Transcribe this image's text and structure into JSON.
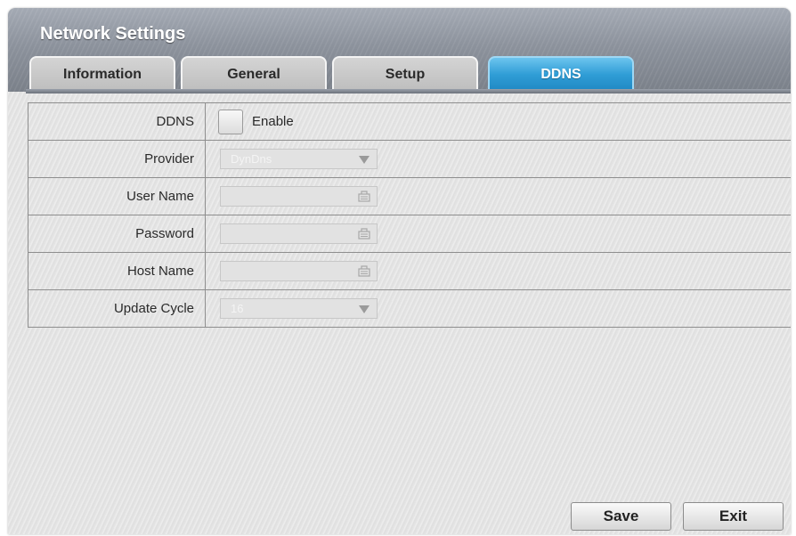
{
  "window": {
    "title": "Network Settings"
  },
  "tabs": [
    {
      "label": "Information",
      "active": false
    },
    {
      "label": "General",
      "active": false
    },
    {
      "label": "Setup",
      "active": false
    },
    {
      "label": "DDNS",
      "active": true
    }
  ],
  "form": {
    "ddns": {
      "label": "DDNS",
      "checkbox_label": "Enable",
      "checked": false
    },
    "provider": {
      "label": "Provider",
      "value": "DynDns",
      "icon": "dropdown-arrow-icon"
    },
    "user_name": {
      "label": "User Name",
      "value": "",
      "icon": "keyboard-icon"
    },
    "password": {
      "label": "Password",
      "value": "",
      "icon": "keyboard-icon"
    },
    "host_name": {
      "label": "Host Name",
      "value": "",
      "icon": "keyboard-icon"
    },
    "update_cycle": {
      "label": "Update Cycle",
      "value": "16",
      "icon": "dropdown-arrow-icon"
    }
  },
  "buttons": {
    "save": "Save",
    "exit": "Exit"
  },
  "colors": {
    "active_tab": "#2f9dd6",
    "title_bar": "#8c929c",
    "panel": "#e6e6e6"
  }
}
